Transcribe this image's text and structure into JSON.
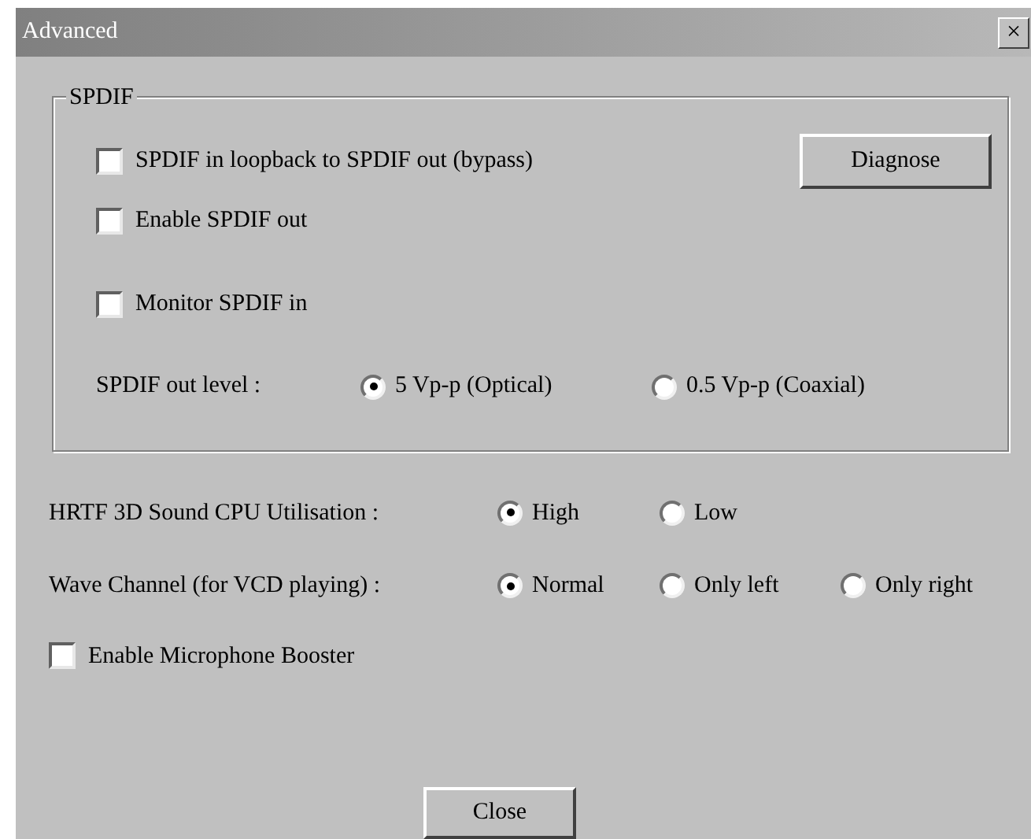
{
  "window": {
    "title": "Advanced",
    "close": "×"
  },
  "spdif": {
    "title": "SPDIF",
    "options": [
      {
        "label": "SPDIF in loopback to SPDIF out (bypass)",
        "checked": false
      },
      {
        "label": "Enable SPDIF out",
        "checked": false
      },
      {
        "label": "Monitor SPDIF in",
        "checked": false
      }
    ],
    "diagnose": "Diagnose",
    "out_level": {
      "label": "SPDIF out level :",
      "choices": [
        {
          "label": "5 Vp-p (Optical)",
          "selected": true
        },
        {
          "label": "0.5 Vp-p (Coaxial)",
          "selected": false
        }
      ]
    }
  },
  "hrtf": {
    "label": "HRTF 3D Sound CPU Utilisation :",
    "choices": [
      {
        "label": "High",
        "selected": true
      },
      {
        "label": "Low",
        "selected": false
      }
    ]
  },
  "wave": {
    "label": "Wave Channel (for VCD playing) :",
    "choices": [
      {
        "label": "Normal",
        "selected": true
      },
      {
        "label": "Only left",
        "selected": false
      },
      {
        "label": "Only right",
        "selected": false
      }
    ]
  },
  "mic_booster": {
    "label": "Enable Microphone Booster",
    "checked": false
  },
  "close_button": "Close"
}
